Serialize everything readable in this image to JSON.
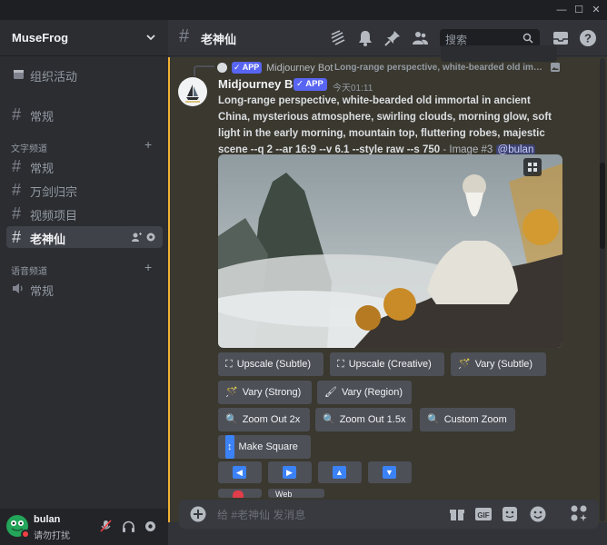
{
  "window": {
    "minimize": "—",
    "maximize": "☐",
    "close": "✕"
  },
  "server": {
    "name": "MuseFrog"
  },
  "sidebar": {
    "top_items": [
      {
        "label": "组织活动",
        "icon": "calendar-icon"
      },
      {
        "label": "常规",
        "icon": "hash-icon"
      }
    ],
    "text_category": "文字频道",
    "text_channels": [
      {
        "label": "常规"
      },
      {
        "label": "万剑归宗"
      },
      {
        "label": "视频项目"
      },
      {
        "label": "老神仙",
        "active": true
      }
    ],
    "voice_category": "语音频道",
    "voice_channels": [
      {
        "label": "常规"
      }
    ]
  },
  "user": {
    "name": "bulan",
    "status": "请勿打扰"
  },
  "channel": {
    "name": "老神仙",
    "search_placeholder": "搜索"
  },
  "reply": {
    "badge": "APP",
    "author": "Midjourney Bot",
    "preview": "Long-range perspective, white-bearded old im…"
  },
  "message": {
    "author": "Midjourney Bot",
    "badge": "APP",
    "timestamp": "今天01:11",
    "prompt": "Long-range perspective, white-bearded old immortal in ancient China, mysterious atmosphere, swirling clouds, morning glow, soft light in the early morning, mountain top, fluttering robes, majestic scene --q 2 --ar 16:9 --v 6.1 --style raw --s 750",
    "suffix": " - Image #3 ",
    "mention": "@bulan"
  },
  "buttons": {
    "upscale_subtle": "Upscale (Subtle)",
    "upscale_creative": "Upscale (Creative)",
    "vary_subtle": "Vary (Subtle)",
    "vary_strong": "Vary (Strong)",
    "vary_region": "Vary (Region)",
    "zoom_2x": "Zoom Out 2x",
    "zoom_15x": "Zoom Out 1.5x",
    "custom_zoom": "Custom Zoom",
    "make_square": "Make Square",
    "web": "Web"
  },
  "composer": {
    "placeholder": "给 #老神仙 发消息"
  },
  "colors": {
    "accent": "#5865f2",
    "yellow_bar": "#f0b232",
    "dnd": "#f23f43",
    "online": "#23a55a"
  }
}
